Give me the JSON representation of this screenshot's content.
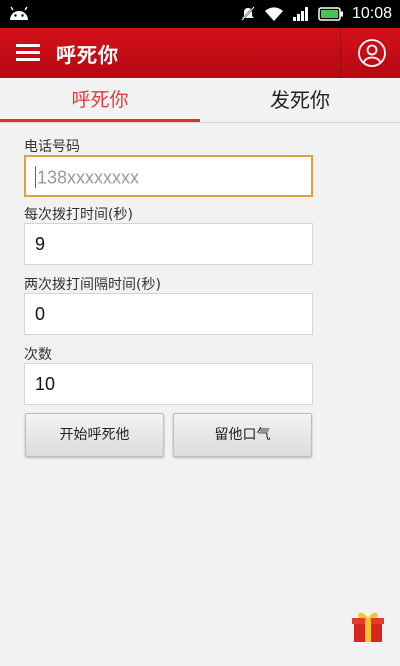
{
  "status_bar": {
    "time": "10:08"
  },
  "app_bar": {
    "title": "呼死你"
  },
  "tabs": [
    {
      "label": "呼死你"
    },
    {
      "label": "发死你"
    }
  ],
  "form": {
    "phone": {
      "label": "电话号码",
      "placeholder": "138xxxxxxxx",
      "value": ""
    },
    "duration": {
      "label": "每次拨打时间(秒)",
      "value": "9"
    },
    "interval": {
      "label": "两次拨打间隔时间(秒)",
      "value": "0"
    },
    "count": {
      "label": "次数",
      "value": "10"
    }
  },
  "buttons": {
    "start": "开始呼死他",
    "stop": "留他口气"
  },
  "colors": {
    "accent": "#d9322f",
    "app_bar": "#c50f17",
    "focus_border": "#e0a040"
  }
}
